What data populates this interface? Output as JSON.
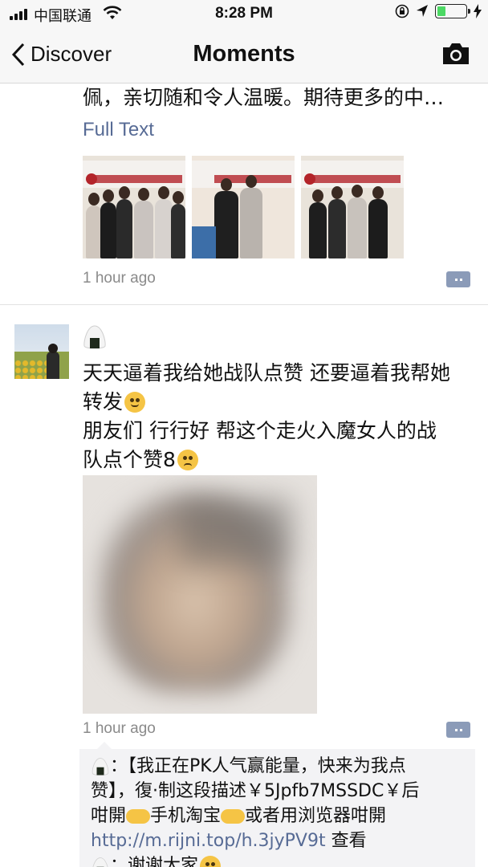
{
  "status_bar": {
    "carrier": "中国联通",
    "time": "8:28 PM"
  },
  "nav": {
    "back_label": "Discover",
    "title": "Moments"
  },
  "post1": {
    "clipped_text": "佩，亲切随和令人温暖。期待更多的中…",
    "full_text_link": "Full Text",
    "time_ago": "1 hour ago",
    "photo_count": 3
  },
  "post2": {
    "username_icon": "rice-ball-icon",
    "line1": "天天逼着我给她战队点赞 还要逼着我帮她",
    "line2": "转发",
    "line3": "朋友们 行行好 帮这个走火入魔女人的战",
    "line4": "队点个赞8",
    "time_ago": "1 hour ago",
    "comments": [
      {
        "name_icon": "rice-ball-icon",
        "sep": "：",
        "text1": "【我正在PK人气赢能量，快来为我点",
        "text2": "赞】，復·制这段描述￥5Jpfb7MSSDC￥后",
        "text3a": "咁開",
        "text3b": "手机淘宝",
        "text3c": "或者用浏览器咁開",
        "link": "http://m.rijni.top/h.3jyPV9t",
        "link_suffix": " 查看"
      },
      {
        "name_icon": "rice-ball-icon",
        "sep": "：",
        "text1": "谢谢大家"
      }
    ]
  },
  "colors": {
    "link": "#576b95",
    "battery": "#4cd964",
    "comment_button": "#8b9bb8"
  }
}
